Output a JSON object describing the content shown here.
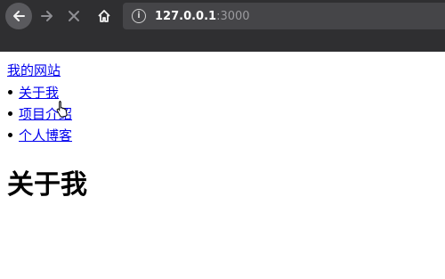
{
  "browser": {
    "url_host": "127.0.0.1",
    "url_port": ":3000",
    "icons": [
      "back-arrow-icon",
      "forward-arrow-icon",
      "stop-icon",
      "home-icon",
      "info-icon"
    ]
  },
  "page": {
    "site_link": "我的网站",
    "nav_items": [
      {
        "label": "关于我"
      },
      {
        "label": "项目介绍"
      },
      {
        "label": "个人博客"
      }
    ],
    "heading": "关于我"
  },
  "colors": {
    "toolbar_bg": "#2f2f31",
    "url_bar_bg": "#454548",
    "link": "#0000ee"
  }
}
